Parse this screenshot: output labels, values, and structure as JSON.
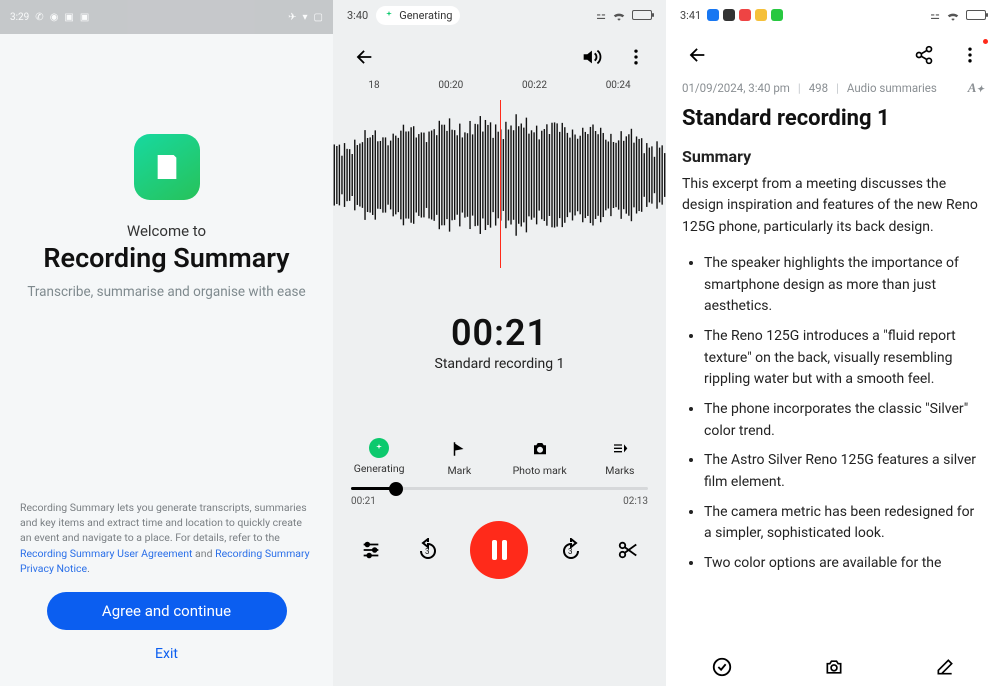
{
  "screen1": {
    "status_time": "3:29",
    "welcome": "Welcome to",
    "title": "Recording Summary",
    "subtitle": "Transcribe, summarise and organise with ease",
    "legal_pre": "Recording Summary lets you generate transcripts, summaries and key items and extract time and location to quickly create an event and navigate to a place. For details, refer to the ",
    "legal_link1": "Recording Summary User Agreement",
    "legal_and": " and ",
    "legal_link2": "Recording Summary Privacy Notice",
    "legal_end": ".",
    "btn_agree": "Agree and continue",
    "btn_exit": "Exit"
  },
  "screen2": {
    "status_time": "3:40",
    "generating_label": "Generating",
    "timeline": {
      "t0": "18",
      "t1": "00:20",
      "t2": "00:22",
      "t3": "00:24"
    },
    "big_time": "00:21",
    "rec_name": "Standard recording 1",
    "mid": {
      "generating": "Generating",
      "mark": "Mark",
      "photo_mark": "Photo mark",
      "marks": "Marks"
    },
    "pos_left": "00:21",
    "pos_right": "02:13"
  },
  "screen3": {
    "status_time": "3:41",
    "meta_date": "01/09/2024, 3:40 pm",
    "meta_count": "498",
    "meta_section": "Audio summaries",
    "title": "Standard recording 1",
    "summary_heading": "Summary",
    "summary_body": "This excerpt from a meeting discusses the design inspiration and features of the new Reno 125G phone, particularly its back design.",
    "bullets": [
      "The speaker highlights the importance of smartphone design as more than just aesthetics.",
      "The Reno 125G introduces a \"fluid report texture\" on the back, visually resembling rippling water but with a smooth feel.",
      "The phone incorporates the classic \"Silver\" color trend.",
      "The Astro Silver Reno 125G features a silver film element.",
      "The camera metric has been redesigned for a simpler, sophisticated look.",
      "Two color options are available for the"
    ]
  }
}
